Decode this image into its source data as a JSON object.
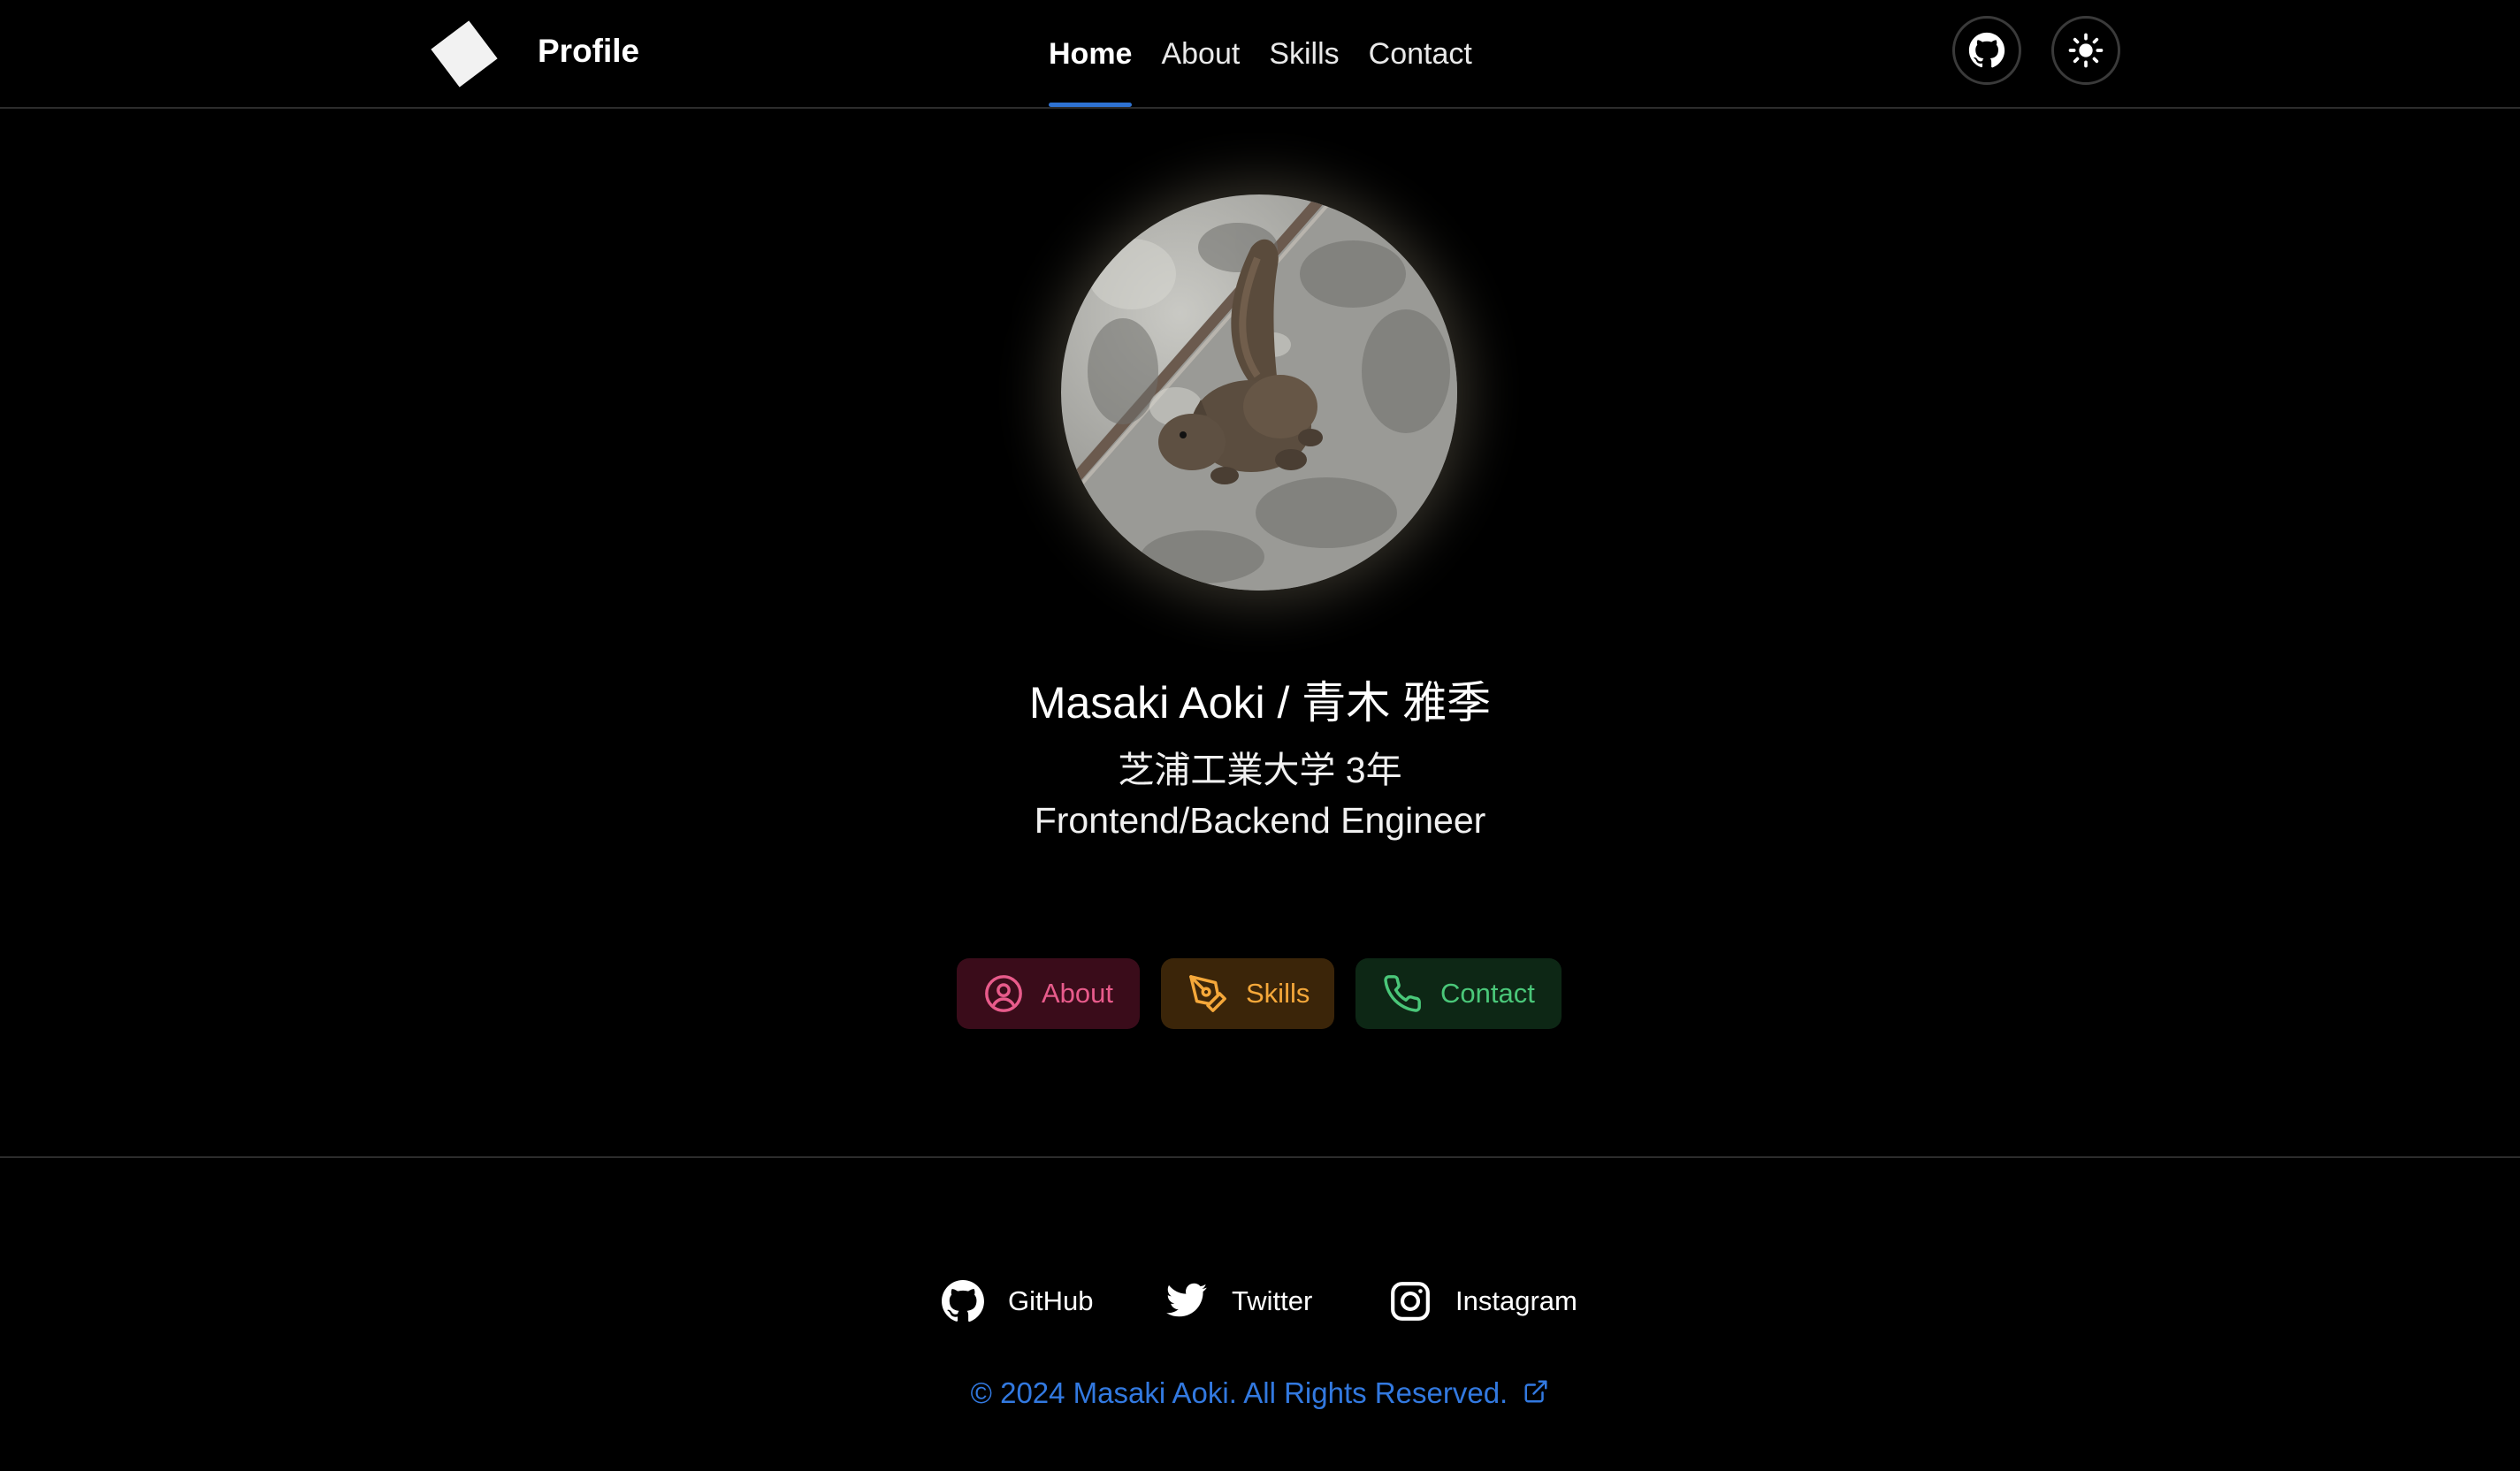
{
  "header": {
    "brand": "Profile",
    "nav": [
      {
        "label": "Home",
        "active": true
      },
      {
        "label": "About",
        "active": false
      },
      {
        "label": "Skills",
        "active": false
      },
      {
        "label": "Contact",
        "active": false
      }
    ],
    "icons": [
      "github-icon",
      "sun-icon"
    ]
  },
  "hero": {
    "name": "Masaki Aoki / 青木 雅季",
    "subtitle_1": "芝浦工業大学 3年",
    "subtitle_2": "Frontend/Backend Engineer",
    "buttons": [
      {
        "label": "About",
        "icon": "user-circle-icon",
        "color": "#e85b8b",
        "bg": "#3a0c1a"
      },
      {
        "label": "Skills",
        "icon": "pen-tool-icon",
        "color": "#f5a83a",
        "bg": "#3b2509"
      },
      {
        "label": "Contact",
        "icon": "phone-icon",
        "color": "#4ac779",
        "bg": "#0d2715"
      }
    ]
  },
  "footer": {
    "links": [
      {
        "label": "GitHub",
        "icon": "github-icon"
      },
      {
        "label": "Twitter",
        "icon": "twitter-icon"
      },
      {
        "label": "Instagram",
        "icon": "instagram-icon"
      }
    ],
    "copyright": "© 2024 Masaki Aoki. All Rights Reserved."
  },
  "colors": {
    "background": "#000000",
    "accent": "#2e72d2",
    "link": "#3279e0"
  }
}
